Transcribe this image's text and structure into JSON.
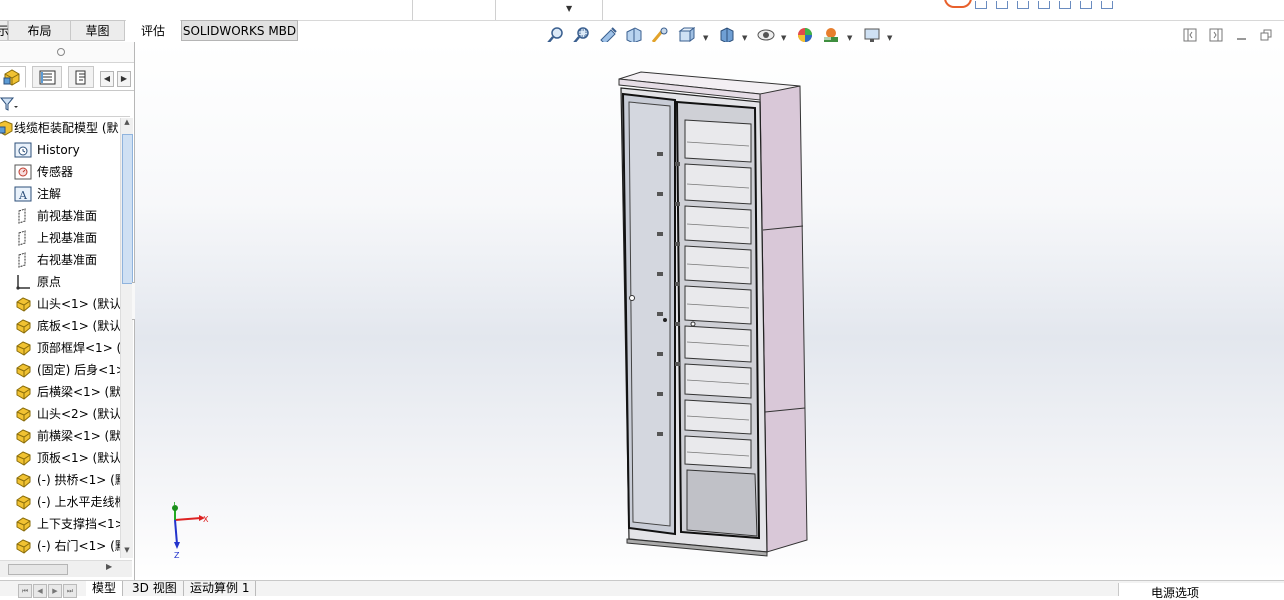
{
  "tabs": [
    {
      "label": "示",
      "state": "partial"
    },
    {
      "label": "布局",
      "state": "normal"
    },
    {
      "label": "草图",
      "state": "normal"
    },
    {
      "label": "评估",
      "state": "plain"
    },
    {
      "label": "SOLIDWORKS MBD",
      "state": "active"
    }
  ],
  "toolbar": {
    "icons": [
      "zoom-to-fit-icon",
      "zoom-to-area-icon",
      "previous-view-icon",
      "section-view-icon",
      "dynamic-annotation-icon",
      "view-orientation-icon",
      "display-style-icon",
      "hide-show-items-icon",
      "edit-appearance-icon",
      "apply-scene-icon",
      "view-settings-icon"
    ]
  },
  "window_controls": [
    "tile-left-icon",
    "tile-right-icon",
    "minimize-icon",
    "restore-icon"
  ],
  "feature_tree": {
    "root": {
      "label": "线缆柜装配模型  (默",
      "icon": "assembly-icon"
    },
    "items": [
      {
        "label": "History",
        "icon": "history-icon"
      },
      {
        "label": "传感器",
        "icon": "sensor-icon"
      },
      {
        "label": "注解",
        "icon": "annotation-icon"
      },
      {
        "label": "前视基准面",
        "icon": "plane-icon"
      },
      {
        "label": "上视基准面",
        "icon": "plane-icon"
      },
      {
        "label": "右视基准面",
        "icon": "plane-icon"
      },
      {
        "label": "原点",
        "icon": "origin-icon"
      },
      {
        "label": "山头<1> (默认",
        "icon": "part-icon"
      },
      {
        "label": "底板<1> (默认",
        "icon": "part-icon"
      },
      {
        "label": "顶部框焊<1> (",
        "icon": "part-icon"
      },
      {
        "label": "(固定) 后身<1>",
        "icon": "part-icon"
      },
      {
        "label": "后横梁<1> (默",
        "icon": "part-icon"
      },
      {
        "label": "山头<2> (默认",
        "icon": "part-icon"
      },
      {
        "label": "前横梁<1> (默",
        "icon": "part-icon"
      },
      {
        "label": "顶板<1> (默认",
        "icon": "part-icon"
      },
      {
        "label": "(-) 拱桥<1> (默",
        "icon": "part-icon"
      },
      {
        "label": "(-) 上水平走线槽",
        "icon": "part-icon"
      },
      {
        "label": "上下支撑挡<1>",
        "icon": "part-icon"
      },
      {
        "label": "(-) 右门<1> (默",
        "icon": "part-icon"
      }
    ]
  },
  "triad": {
    "x_label": "X",
    "y_label": "Y",
    "z_label": "Z"
  },
  "bottom_tabs": [
    {
      "label": "模型",
      "active": true
    },
    {
      "label": "3D 视图",
      "active": false
    },
    {
      "label": "运动算例 1",
      "active": false
    }
  ],
  "status": {
    "text": "电源选项"
  },
  "colors": {
    "cabinet_side": "#d9c8d8",
    "accent_blue": "#2b6cc4",
    "part_yellow": "#f1c232"
  }
}
